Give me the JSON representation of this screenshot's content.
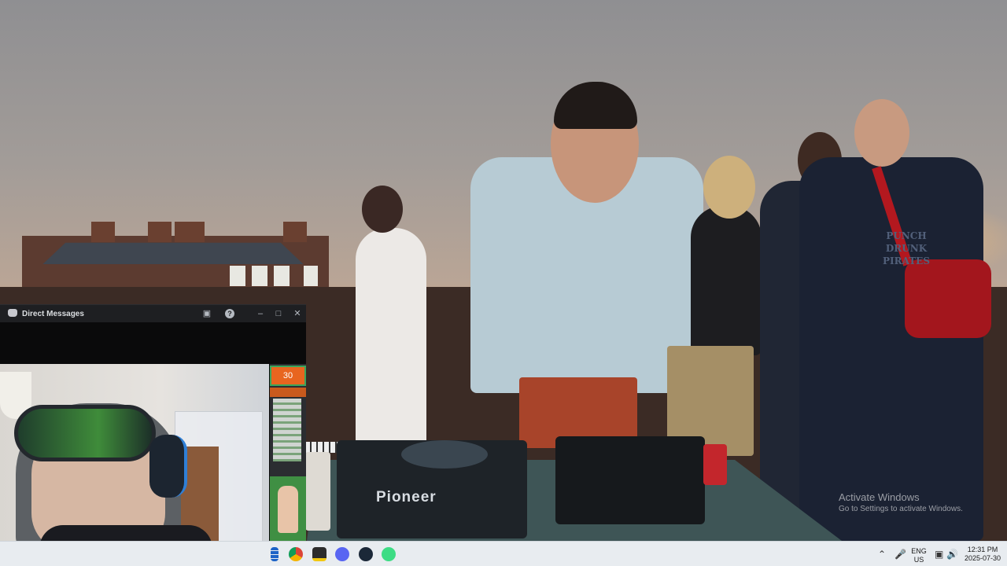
{
  "video": {
    "mixer_brand": "Pioneer",
    "shirt_print": [
      "PUNCH DRUNK",
      "PIRATES"
    ]
  },
  "discord_window": {
    "title": "Direct Messages",
    "side_badge": "30"
  },
  "watermark": {
    "line1": "Activate Windows",
    "line2": "Go to Settings to activate Windows."
  },
  "taskbar": {
    "apps": [
      "start-icon",
      "chrome-icon",
      "sticky-notes-icon",
      "discord-icon",
      "steam-icon",
      "android-icon"
    ],
    "tray": {
      "language": "ENG",
      "region": "US",
      "time": "12:31 PM",
      "date": "2025-07-30"
    }
  },
  "colors": {
    "taskbar_bg": "#e8ecf0",
    "discord_titlebar": "#1e1f22",
    "accent_orange": "#e8651f"
  }
}
